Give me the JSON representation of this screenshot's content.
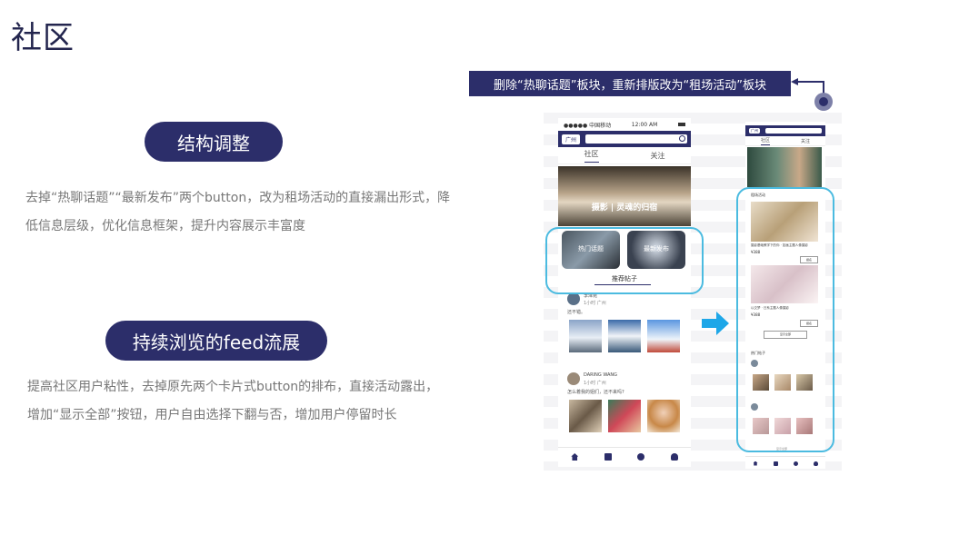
{
  "title": "社区",
  "section1": {
    "pill": "结构调整",
    "desc_line1": "去掉“热聊话题”“最新发布”两个button，改为租场活动的直接漏出形式，降",
    "desc_line2": "低信息层级，优化信息框架，提升内容展示丰富度"
  },
  "section2": {
    "pill": "持续浏览的feed流展",
    "desc_line1": "提高社区用户粘性，去掉原先两个卡片式button的排布，直接活动露出，",
    "desc_line2": "增加“显示全部”按钮，用户自由选择下翻与否，增加用户停留时长"
  },
  "callout": "删除“热聊话题”板块，重新排版改为“租场活动”板块",
  "phone_left": {
    "carrier": "●●●●● 中国移动",
    "time": "12:00 AM",
    "location": "广州",
    "tab_community": "社区",
    "tab_follow": "关注",
    "hero_title": "摄影 | 灵魂的归宿",
    "card1": "热门话题",
    "card2": "最新发布",
    "recommend": "推荐帖子",
    "post1_user": "李泽昆",
    "post1_meta": "1小时 广州",
    "post1_text": "还不错。",
    "post2_user": "DARING WANG",
    "post2_meta": "1小时 广州",
    "post2_text": "怎么着我的姐们，还不来吗?"
  },
  "phone_right": {
    "location": "广州",
    "tab_community": "社区",
    "tab_follow": "关注",
    "activities_title": "租场活动",
    "act1_title": "摄影基础教学下的你 · 如画主题人像摄影",
    "act1_price": "¥388",
    "act1_btn": "报名",
    "act2_title": "以交梦 · 日系主题人像摄影",
    "act2_price": "¥388",
    "act2_btn": "报名",
    "show_all_1": "显示全部",
    "hot_posts": "热门帖子",
    "show_all_2": "显示全部"
  },
  "colors": {
    "navy": "#2c2e6a",
    "highlight": "#4bbbe0",
    "arrow": "#1ea7e8"
  }
}
